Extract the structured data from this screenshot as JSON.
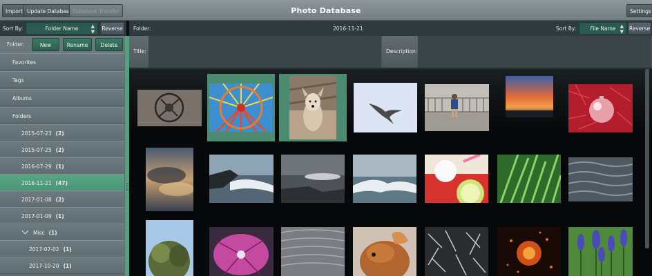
{
  "toolbar": {
    "import_label": "Import",
    "update_db_label": "Update Database",
    "transfer_label": "Database Transfer",
    "title": "Photo Database",
    "settings_label": "Settings"
  },
  "left_panel": {
    "sort_by_label": "Sort By:",
    "sort_value": "Folder Name",
    "reverse_label": "Reverse",
    "folder_label": "Folder:",
    "new_label": "New",
    "rename_label": "Rename",
    "delete_label": "Delete",
    "tree": [
      {
        "label": "Favorites",
        "count": ""
      },
      {
        "label": "Tags",
        "count": ""
      },
      {
        "label": "Albums",
        "count": ""
      },
      {
        "label": "Folders",
        "count": ""
      },
      {
        "label": "2015-07-23",
        "count": "(2)"
      },
      {
        "label": "2015-07-25",
        "count": "(2)"
      },
      {
        "label": "2016-07-29",
        "count": "(1)"
      },
      {
        "label": "2016-11-21",
        "count": "(47)"
      },
      {
        "label": "2017-01-08",
        "count": "(2)"
      },
      {
        "label": "2017-01-09",
        "count": "(1)"
      },
      {
        "label": "Misc",
        "count": "(1)"
      },
      {
        "label": "2017-07-02",
        "count": "(1)"
      },
      {
        "label": "2017-10-20",
        "count": "(1)"
      }
    ]
  },
  "main": {
    "folder_label": "Folder:",
    "folder_value": "2016-11-21",
    "sort_by_label": "Sort By:",
    "sort_value": "File Name",
    "reverse_label": "Reverse",
    "title_label": "Title:",
    "description_label": "Description:"
  },
  "colors": {
    "accent_green": "#4fa37f",
    "selection_green": "#4a8b72",
    "toolbar_gray": "#8e979c"
  },
  "icons": {
    "sort_arrows": "updown-arrows-icon",
    "misc_expand": "chevron-down-icon"
  }
}
